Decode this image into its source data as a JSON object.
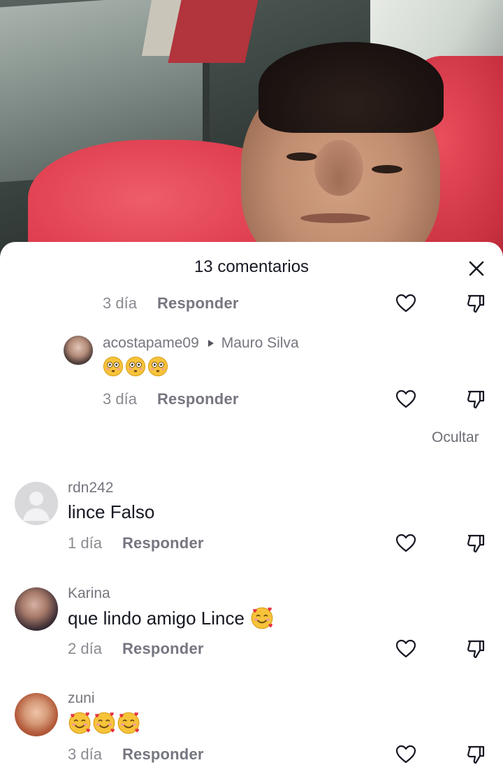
{
  "sheet": {
    "title": "13 comentarios"
  },
  "comments": [
    {
      "time": "3 día",
      "reply_label": "Responder"
    },
    {
      "username": "acostapame09",
      "reply_to_user": "Mauro Silva",
      "emojis": [
        "flushed-face",
        "flushed-face",
        "flushed-face"
      ],
      "time": "3 día",
      "reply_label": "Responder"
    },
    {
      "username": "rdn242",
      "text": "lince Falso",
      "time": "1 día",
      "reply_label": "Responder"
    },
    {
      "username": "Karina",
      "text": "que lindo amigo Lince",
      "emojis": [
        "smiling-face-with-hearts"
      ],
      "time": "2 día",
      "reply_label": "Responder"
    },
    {
      "username": "zuni",
      "emojis": [
        "smiling-face-with-hearts",
        "smiling-face-with-hearts",
        "smiling-face-with-hearts"
      ],
      "time": "3 día",
      "reply_label": "Responder"
    }
  ],
  "hide_label": "Ocultar",
  "icons": {
    "close": "close-icon",
    "like": "heart-icon",
    "dislike": "thumbs-down-icon",
    "reply_arrow": "triangle-right-icon"
  },
  "colors": {
    "text_primary": "#161823",
    "text_secondary": "#8a8b91",
    "sheet_bg": "#ffffff"
  }
}
